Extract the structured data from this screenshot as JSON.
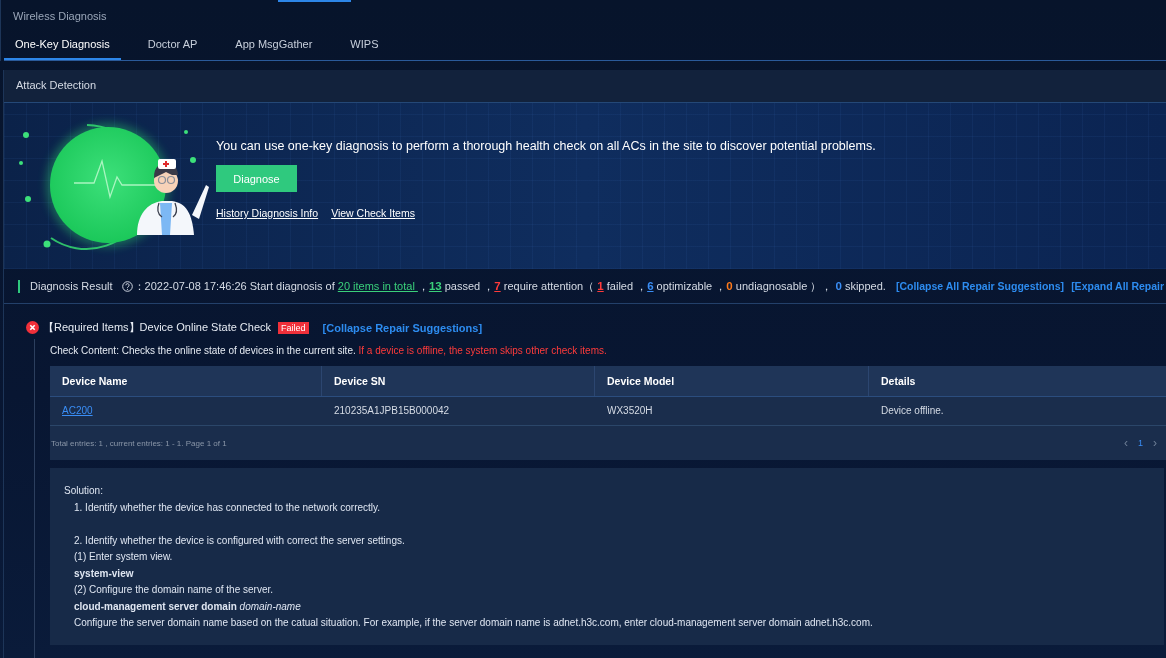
{
  "app_title": "Wireless Diagnosis",
  "tabs": [
    {
      "label": "One-Key Diagnosis",
      "selected": true
    },
    {
      "label": "Doctor AP",
      "selected": false
    },
    {
      "label": "App MsgGather",
      "selected": false
    },
    {
      "label": "WIPS",
      "selected": false
    }
  ],
  "panel": {
    "title": "Attack Detection"
  },
  "hero": {
    "intro": "You can use one-key diagnosis to perform a thorough health check on all ACs in the site to discover potential problems.",
    "button": "Diagnose",
    "links": [
      "History Diagnosis Info",
      "View Check Items"
    ]
  },
  "summary": {
    "label": "Diagnosis Result",
    "parts": [
      {
        "kind": "text",
        "text": "：2022-07-08 17:46:26 Start diagnosis of "
      },
      {
        "kind": "link",
        "text": "20 items in total ",
        "color": "#3ad07a"
      },
      {
        "kind": "text",
        "text": " ，"
      },
      {
        "kind": "link",
        "text": "13",
        "color": "#3ad07a"
      },
      {
        "kind": "text",
        "text": " passed ，"
      },
      {
        "kind": "link",
        "text": "7",
        "color": "#ff3b3b"
      },
      {
        "kind": "text",
        "text": " require attention（ "
      },
      {
        "kind": "link",
        "text": "1",
        "color": "#ff3b3b"
      },
      {
        "kind": "text",
        "text": " failed ，"
      },
      {
        "kind": "link",
        "text": "6",
        "color": "#3a8ef6"
      },
      {
        "kind": "text",
        "text": " optimizable ，"
      },
      {
        "kind": "count",
        "text": "0",
        "color": "#ff7a1a"
      },
      {
        "kind": "text",
        "text": " undiagnosable ）， "
      },
      {
        "kind": "count",
        "text": "0",
        "color": "#3a8ef6"
      },
      {
        "kind": "text",
        "text": " skipped."
      }
    ],
    "actions": [
      "[Collapse All Repair Suggestions]",
      "[Expand All Repair"
    ]
  },
  "checks": [
    {
      "failed": true,
      "title": "【Required Items】Device Online State Check",
      "badge": "Failed",
      "toggle": "[Collapse Repair Suggestions]",
      "content": "Check Content: Checks the online state of devices in the current site. ",
      "warning": "If a device is offline, the system skips other check items.",
      "table": {
        "columns": [
          "Device Name",
          "Device SN",
          "Device Model",
          "Details"
        ],
        "rows": [
          [
            "AC200",
            "210235A1JPB15B000042",
            "WX3520H",
            "Device offline."
          ]
        ]
      },
      "pagination": {
        "summary": "Total entries: 1 , current entries: 1 - 1. Page 1 of 1",
        "previous": "‹",
        "pages": [
          {
            "label": "1",
            "selected": true
          }
        ],
        "next": "›"
      },
      "solution": [
        {
          "kind": "heading",
          "text": "Solution:"
        },
        {
          "kind": "plain",
          "text": "1. Identify whether the device has connected to the network correctly."
        },
        {
          "kind": "gap"
        },
        {
          "kind": "plain",
          "text": "2. Identify whether the device is configured with correct the server settings."
        },
        {
          "kind": "plain",
          "text": "(1) Enter system view."
        },
        {
          "kind": "command",
          "text": "system-view"
        },
        {
          "kind": "plain",
          "text": "(2) Configure the domain name of the server."
        },
        {
          "kind": "plain",
          "text": "**cloud-management server domain** *domain-name*"
        },
        {
          "kind": "plain",
          "text": "Configure the server domain name based on the catual situation. For example, if the server domain name is adnet.h3c.com, enter cloud-management server domain adnet.h3c.com."
        }
      ]
    }
  ]
}
